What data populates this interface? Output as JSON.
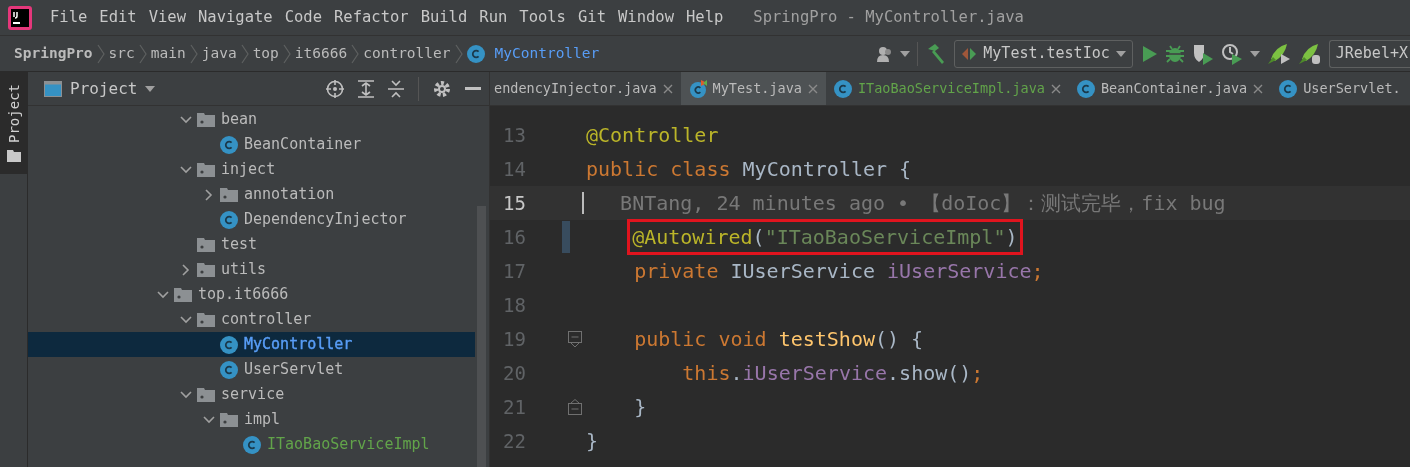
{
  "app": {
    "title": "SpringPro - MyController.java"
  },
  "menu": [
    "File",
    "Edit",
    "View",
    "Navigate",
    "Code",
    "Refactor",
    "Build",
    "Run",
    "Tools",
    "Git",
    "Window",
    "Help"
  ],
  "breadcrumbs": [
    {
      "label": "SpringPro",
      "kind": "project"
    },
    {
      "label": "src",
      "kind": "folder"
    },
    {
      "label": "main",
      "kind": "folder"
    },
    {
      "label": "java",
      "kind": "folder"
    },
    {
      "label": "top",
      "kind": "folder"
    },
    {
      "label": "it6666",
      "kind": "folder"
    },
    {
      "label": "controller",
      "kind": "folder"
    },
    {
      "label": "MyController",
      "kind": "class"
    }
  ],
  "toolbar": {
    "run_config": "MyTest.testIoc",
    "jrebel_config": "JRebel+X"
  },
  "tool_windows": [
    {
      "label": "Project",
      "selected": true
    }
  ],
  "project_panel": {
    "title": "Project",
    "tree_partial": [
      {
        "label": "bean",
        "kind": "folder",
        "expanded": true,
        "selected": false,
        "children": [
          {
            "label": "BeanContainer",
            "kind": "class",
            "selected": false,
            "color": "#bbbbbb"
          }
        ]
      },
      {
        "label": "inject",
        "kind": "folder",
        "expanded": true,
        "selected": false,
        "children": [
          {
            "label": "annotation",
            "kind": "folder",
            "expanded": false,
            "selected": false
          },
          {
            "label": "DependencyInjector",
            "kind": "class",
            "selected": false,
            "color": "#bbbbbb"
          }
        ]
      },
      {
        "label": "test",
        "kind": "folder",
        "selected": false
      },
      {
        "label": "utils",
        "kind": "folder",
        "expanded": false,
        "selected": false
      }
    ],
    "tree": [
      {
        "label": "top.it6666",
        "kind": "folder",
        "expanded": true,
        "selected": false,
        "children": [
          {
            "label": "controller",
            "kind": "folder",
            "expanded": true,
            "selected": false,
            "children": [
              {
                "label": "MyController",
                "kind": "class",
                "selected": true
              },
              {
                "label": "UserServlet",
                "kind": "class",
                "selected": false,
                "color": "#bbbbbb"
              }
            ]
          },
          {
            "label": "service",
            "kind": "folder",
            "expanded": true,
            "selected": false,
            "children": [
              {
                "label": "impl",
                "kind": "folder",
                "expanded": true,
                "selected": false,
                "children": [
                  {
                    "label": "ITaoBaoServiceImpl",
                    "kind": "class",
                    "selected": false,
                    "color": "#62a44a"
                  }
                ]
              }
            ]
          }
        ]
      }
    ]
  },
  "tabs": [
    {
      "label": "endencyInjector.java",
      "kind": "cut",
      "selected": false,
      "color": "#bbbbbb"
    },
    {
      "label": "MyTest.java",
      "kind": "test",
      "selected": true,
      "color": "#bbbbbb"
    },
    {
      "label": "ITaoBaoServiceImpl.java",
      "kind": "class",
      "selected": false,
      "color": "#62a44a"
    },
    {
      "label": "BeanContainer.java",
      "kind": "class",
      "selected": false,
      "color": "#bbbbbb"
    },
    {
      "label": "UserServlet.",
      "kind": "class",
      "selected": false,
      "color": "#bbbbbb"
    }
  ],
  "editor": {
    "lines": [
      {
        "number": "13",
        "kind": "code",
        "current": false,
        "changed": false,
        "highlighted": false,
        "fold_start": false,
        "fold_end": false,
        "tokens": [
          {
            "kind": "annotation",
            "text": "@Controller"
          }
        ]
      },
      {
        "number": "14",
        "kind": "code",
        "current": false,
        "changed": false,
        "highlighted": false,
        "fold_start": false,
        "fold_end": false,
        "tokens": [
          {
            "kind": "keyword",
            "text": "public class "
          },
          {
            "kind": "plain",
            "text": "MyController {"
          }
        ],
        "children": [
          {
            "number": "15",
            "kind": "blame",
            "current": true,
            "changed": false,
            "highlighted": false,
            "fold_start": false,
            "fold_end": false,
            "text": "BNTang, 24 minutes ago • 【doIoc】：测试完毕，fix bug"
          },
          {
            "number": "16",
            "kind": "code",
            "current": false,
            "changed": true,
            "highlighted": true,
            "fold_start": false,
            "fold_end": false,
            "tokens": [
              {
                "kind": "annotation",
                "text": "@Autowired"
              },
              {
                "kind": "plain",
                "text": "("
              },
              {
                "kind": "string",
                "text": "\"ITaoBaoServiceImpl\""
              },
              {
                "kind": "plain",
                "text": ")"
              }
            ]
          },
          {
            "number": "17",
            "kind": "code",
            "current": false,
            "changed": false,
            "highlighted": false,
            "fold_start": false,
            "fold_end": false,
            "tokens": [
              {
                "kind": "keyword",
                "text": "private "
              },
              {
                "kind": "plain",
                "text": "IUserService "
              },
              {
                "kind": "field",
                "text": "iUserService"
              },
              {
                "kind": "keyword",
                "text": ";"
              }
            ]
          },
          {
            "number": "18",
            "kind": "code",
            "current": false,
            "changed": false,
            "highlighted": false,
            "fold_start": false,
            "fold_end": false
          },
          {
            "number": "19",
            "kind": "code",
            "current": false,
            "changed": false,
            "highlighted": false,
            "fold_start": true,
            "fold_end": false,
            "tokens": [
              {
                "kind": "keyword",
                "text": "public void "
              },
              {
                "kind": "method",
                "text": "testShow"
              },
              {
                "kind": "plain",
                "text": "() {"
              }
            ],
            "children": [
              {
                "number": "20",
                "kind": "code",
                "current": false,
                "changed": false,
                "highlighted": false,
                "fold_start": false,
                "fold_end": false,
                "tokens": [
                  {
                    "kind": "keyword",
                    "text": "this"
                  },
                  {
                    "kind": "plain",
                    "text": "."
                  },
                  {
                    "kind": "field",
                    "text": "iUserService"
                  },
                  {
                    "kind": "plain",
                    "text": ".show()"
                  },
                  {
                    "kind": "keyword",
                    "text": ";"
                  }
                ]
              }
            ]
          },
          {
            "number": "21",
            "kind": "code",
            "current": false,
            "changed": false,
            "highlighted": false,
            "fold_start": false,
            "fold_end": true,
            "tokens": [
              {
                "kind": "plain",
                "text": "}"
              }
            ]
          }
        ]
      },
      {
        "number": "22",
        "kind": "code",
        "current": false,
        "changed": false,
        "highlighted": false,
        "fold_start": false,
        "fold_end": false,
        "tokens": [
          {
            "kind": "plain",
            "text": "}"
          }
        ]
      }
    ]
  }
}
